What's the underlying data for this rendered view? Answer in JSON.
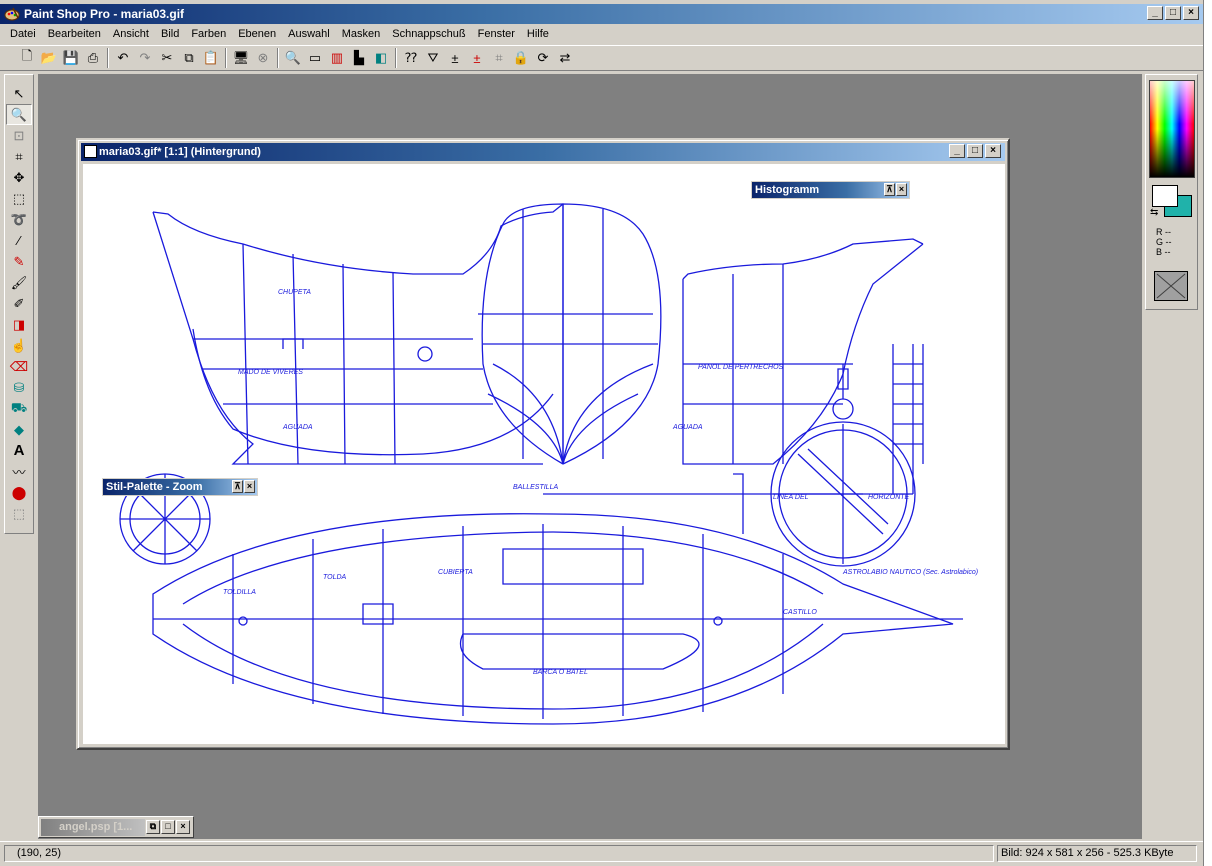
{
  "app": {
    "title": "Paint Shop Pro - maria03.gif",
    "window_buttons": [
      "_",
      "□",
      "×"
    ]
  },
  "menu": {
    "items": [
      "Datei",
      "Bearbeiten",
      "Ansicht",
      "Bild",
      "Farben",
      "Ebenen",
      "Auswahl",
      "Masken",
      "Schnappschuß",
      "Fenster",
      "Hilfe"
    ]
  },
  "toolbar": {
    "icons": [
      "new-icon",
      "open-icon",
      "save-icon",
      "print-icon",
      "undo-icon",
      "redo-icon",
      "cut-icon",
      "copy-icon",
      "paste-icon",
      "browse-icon",
      "cancel-icon",
      "zoom-icon",
      "overview-icon",
      "color-palette-icon",
      "histogram-icon",
      "layers-icon",
      "help-context-icon",
      "filter-icon",
      "adjust-a-icon",
      "adjust-b-icon",
      "deform-icon",
      "lock-icon",
      "rotate-icon",
      "flip-icon"
    ]
  },
  "document": {
    "title": "maria03.gif* [1:1] (Hintergrund)"
  },
  "palettes": {
    "histogram": "Histogramm",
    "style_zoom": "Stil-Palette - Zoom"
  },
  "minimized_doc": {
    "title": "angel.psp [1..."
  },
  "color_panel": {
    "r": "R --",
    "g": "G --",
    "b": "B --",
    "bg_color": "#20b2aa"
  },
  "status": {
    "coords": "(190, 25)",
    "image_info": "Bild:  924 x 581 x 256 - 525.3 KByte"
  }
}
